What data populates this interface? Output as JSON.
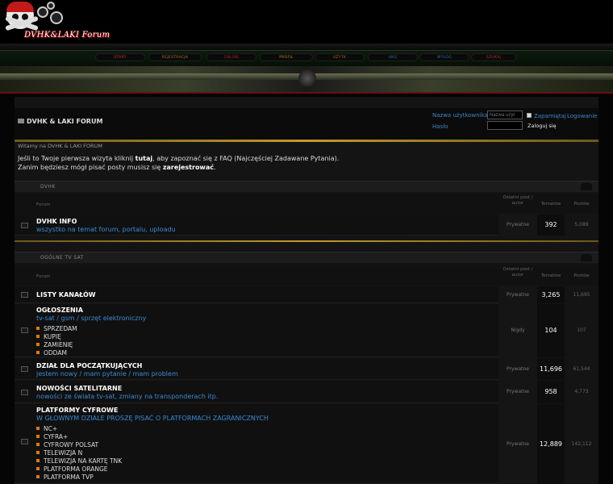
{
  "logo": {
    "text": "DVHK&LAKI Forum"
  },
  "nav": {
    "items": [
      {
        "label": "START",
        "color": "#cc3a2a"
      },
      {
        "label": "REJESTRACJA",
        "color": "#b07030"
      },
      {
        "label": "ONLINE",
        "color": "#b02020"
      },
      {
        "label": "PROFIL",
        "color": "#b08030"
      },
      {
        "label": "UŻYTK",
        "color": "#b06030"
      },
      {
        "label": "UKG",
        "color": "#3070b0"
      },
      {
        "label": "WYLOG",
        "color": "#3070b0"
      },
      {
        "label": "SZUKAJ",
        "color": "#c03030"
      }
    ]
  },
  "header": {
    "title": "DVHK & LAKI FORUM"
  },
  "login": {
    "username_label": "Nazwa użytkownika",
    "username_placeholder": "Nazwa użyt",
    "password_label": "Hasło",
    "remember_label": "Zapamiętaj",
    "login_link": "Logowanie",
    "submit_label": "Zaloguj się"
  },
  "welcome": {
    "title": "Witamy na DVHK & LAKI FORUM",
    "line1_a": "Jeśli to Twoje pierwsza wizyta kliknij ",
    "line1_b": "tutaj",
    "line1_c": ", aby zapoznać się z FAQ (Najczęściej Zadawane Pytania).",
    "line2_a": "Zanim będziesz mógł pisać posty musisz się ",
    "line2_b": "zarejestrować",
    "line2_c": "."
  },
  "columns": {
    "forum": "Forum",
    "last_post": "Ostatni post / autor",
    "topics": "Tematów",
    "posts": "Postów"
  },
  "categories": [
    {
      "name": "DVHK"
    },
    {
      "name": "OGÓLNE TV SAT"
    }
  ],
  "forums": [
    {
      "name": "DVHK INFO",
      "desc": "wszystko na temat forum, portalu, uploadu",
      "last": "Prywatne",
      "topics": "392",
      "posts": "5,089"
    },
    {
      "name": "LISTY KANAŁÓW",
      "desc": "",
      "last": "Prywatne",
      "topics": "3,265",
      "posts": "11,695"
    },
    {
      "name": "OGŁOSZENIA",
      "desc": "tv-sat / gsm / sprzęt elektroniczny",
      "subs": [
        "SPRZEDAM",
        "KUPIĘ",
        "ZAMIENIĘ",
        "ODDAM"
      ],
      "last": "Nigdy",
      "topics": "104",
      "posts": "107"
    },
    {
      "name": "DZIAŁ DLA POCZĄTKUJĄCYCH",
      "desc": "jestem nowy / mam pytanie / mam problem",
      "last": "Prywatne",
      "topics": "11,696",
      "posts": "61,544"
    },
    {
      "name": "NOWOŚCI SATELITARNE",
      "desc": "nowości ze świata tv-sat, zmiany na transponderach itp.",
      "last": "Prywatne",
      "topics": "958",
      "posts": "4,773"
    },
    {
      "name": "PLATFORMY CYFROWE",
      "desc": "W GŁOWNYM DZIALE PROSZĘ PISAĆ O PLATFORMACH ZAGRANICZNYCH",
      "subs": [
        "NC+",
        "CYFRA+",
        "CYFROWY POLSAT",
        "TELEWIZJA N",
        "TELEWIZJA NA KARTĘ TNK",
        "PLATFORMA ORANGE",
        "PLATFORMA TVP"
      ],
      "last": "Prywatne",
      "topics": "12,889",
      "posts": "142,112"
    }
  ]
}
